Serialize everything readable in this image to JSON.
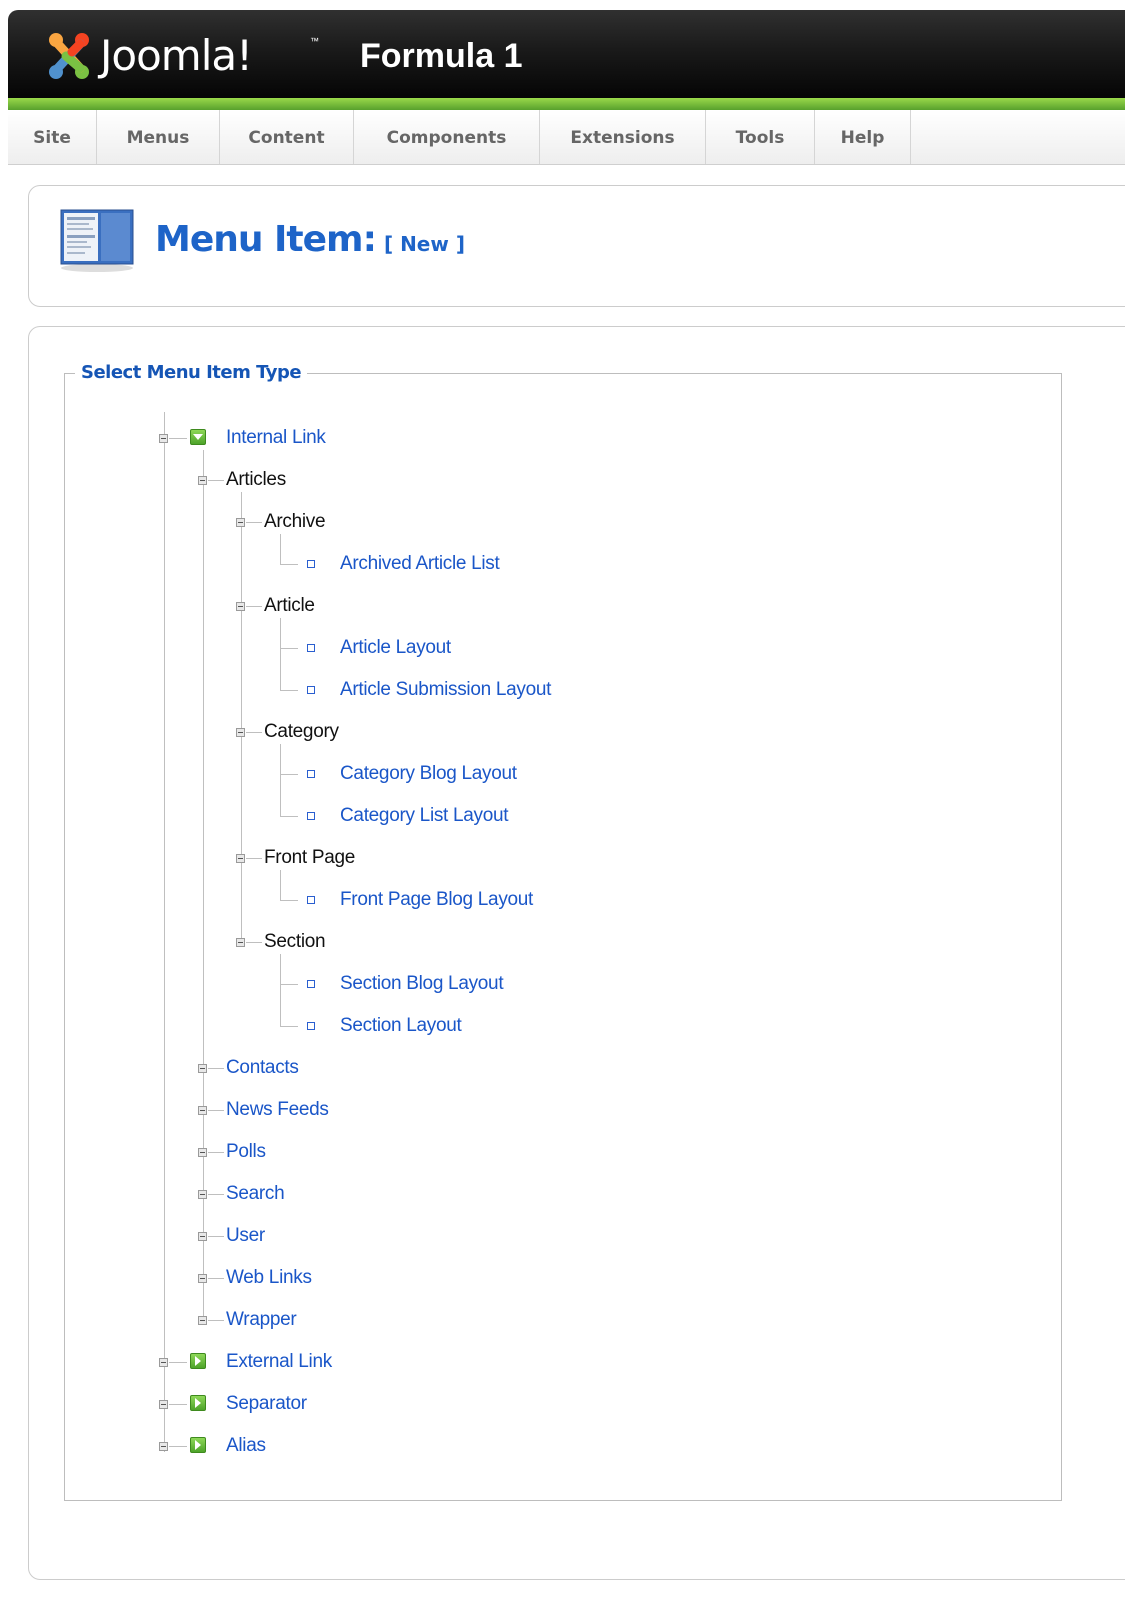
{
  "header": {
    "logo_text": "Joomla!",
    "logo_tm": "™",
    "site_name": "Formula 1"
  },
  "menubar": {
    "items": [
      "Site",
      "Menus",
      "Content",
      "Components",
      "Extensions",
      "Tools",
      "Help"
    ]
  },
  "page": {
    "title": "Menu Item:",
    "subtitle": "[ New ]"
  },
  "fieldset": {
    "legend": "Select Menu Item Type"
  },
  "tree": {
    "internal_link": "Internal Link",
    "articles": "Articles",
    "archive": "Archive",
    "archived_article_list": "Archived Article List",
    "article": "Article",
    "article_layout": "Article Layout",
    "article_submission_layout": "Article Submission Layout",
    "category": "Category",
    "category_blog_layout": "Category Blog Layout",
    "category_list_layout": "Category List Layout",
    "front_page": "Front Page",
    "front_page_blog_layout": "Front Page Blog Layout",
    "section": "Section",
    "section_blog_layout": "Section Blog Layout",
    "section_layout": "Section Layout",
    "contacts": "Contacts",
    "news_feeds": "News Feeds",
    "polls": "Polls",
    "search": "Search",
    "user": "User",
    "web_links": "Web Links",
    "wrapper": "Wrapper",
    "external_link": "External Link",
    "separator": "Separator",
    "alias": "Alias"
  },
  "colors": {
    "accent_green": "#58a12d",
    "link_blue": "#1a56c8",
    "title_blue": "#1e64c8"
  }
}
